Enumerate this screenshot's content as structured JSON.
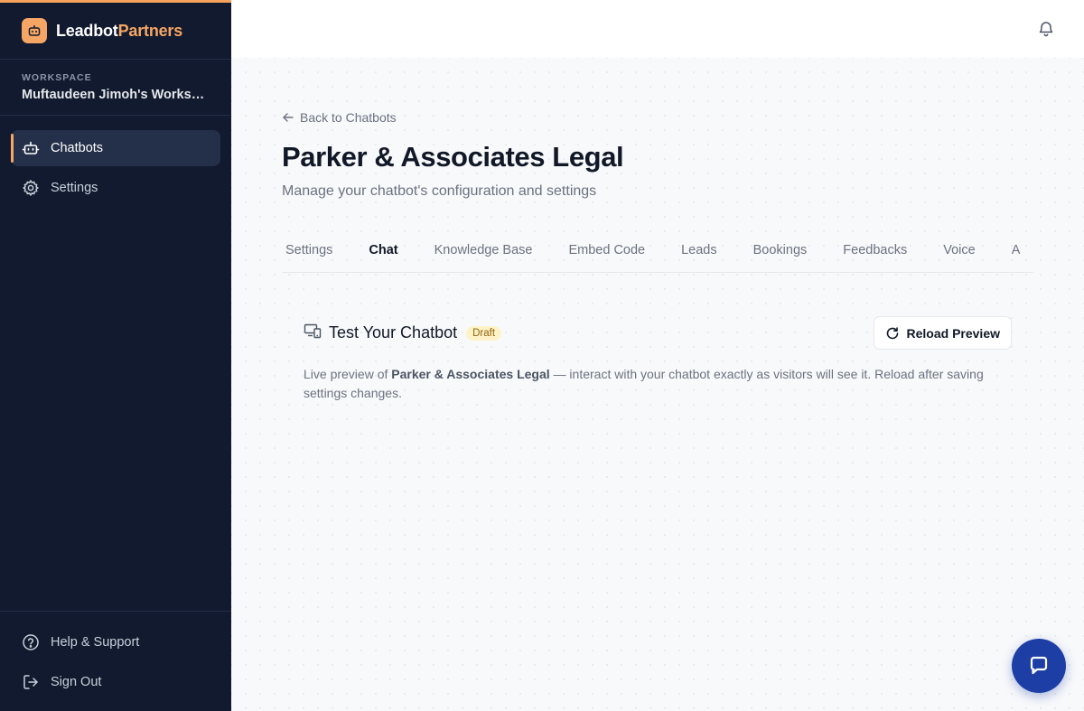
{
  "brand": {
    "name_part1": "Leadbot",
    "name_part2": "Partners",
    "logo_icon": "robot-icon"
  },
  "workspace": {
    "label": "WORKSPACE",
    "name": "Muftaudeen Jimoh's Workspace"
  },
  "nav": {
    "items": [
      {
        "label": "Chatbots",
        "icon": "bot-icon",
        "active": true
      },
      {
        "label": "Settings",
        "icon": "gear-icon",
        "active": false
      }
    ]
  },
  "footer": {
    "help_label": "Help & Support",
    "signout_label": "Sign Out"
  },
  "header": {
    "notifications_icon": "bell-icon"
  },
  "page": {
    "back_label": "Back to Chatbots",
    "title": "Parker & Associates Legal",
    "subtitle": "Manage your chatbot's configuration and settings"
  },
  "tabs": [
    {
      "label": "Settings",
      "active": false
    },
    {
      "label": "Chat",
      "active": true
    },
    {
      "label": "Knowledge Base",
      "active": false
    },
    {
      "label": "Embed Code",
      "active": false
    },
    {
      "label": "Leads",
      "active": false
    },
    {
      "label": "Bookings",
      "active": false
    },
    {
      "label": "Feedbacks",
      "active": false
    },
    {
      "label": "Voice",
      "active": false
    },
    {
      "label": "A",
      "active": false
    }
  ],
  "panel": {
    "title": "Test Your Chatbot",
    "badge": "Draft",
    "reload_label": "Reload Preview",
    "desc_prefix": "Live preview of ",
    "desc_bot": "Parker & Associates Legal",
    "desc_suffix": " — interact with your chatbot exactly as visitors will see it. Reload after saving settings changes."
  },
  "colors": {
    "accent": "#f6a664",
    "sidebar_bg": "#111a2e",
    "fab": "#1d3fa5"
  }
}
